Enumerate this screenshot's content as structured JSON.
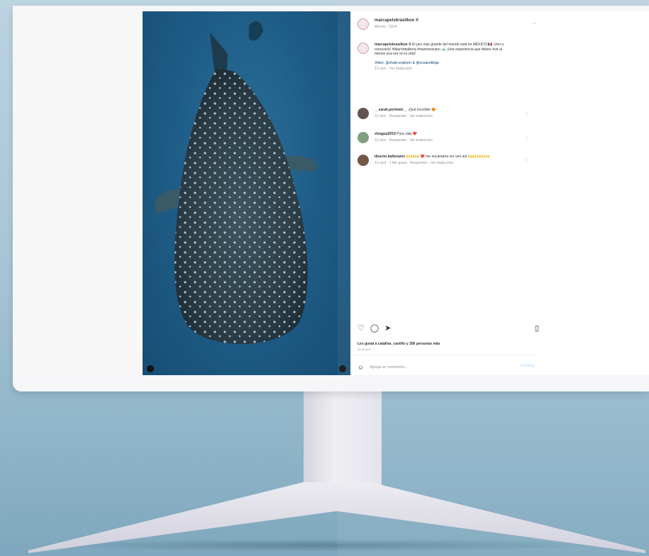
{
  "header": {
    "username": "marcapelsbrasilkoe ®",
    "subtitle": "México · 2024",
    "more_icon": "more-horizontal-icon"
  },
  "caption": {
    "username": "marcapelsbrasilkoe ®",
    "text": "El pez más grande del mundo está en MÉXICO 🇲🇽 ¡Ven a conocerlo! #tiburónballena #marmexicano 🐋 ¡Una experiencia que debes vivir al menos una vez en la vida!",
    "credit": "Video: @shark.explorer & @oceanofbaja",
    "meta": "13 sem · Ver traducción"
  },
  "comments": [
    {
      "username": "__sarah.perlewin__",
      "text": "¡Qué increíble 😍",
      "meta": "13 sem · Responder · Ver traducción",
      "avatar": "dark"
    },
    {
      "username": "vivagua2019",
      "text": "Pura vida ❤️",
      "meta": "13 sem · Responder · Ver traducción",
      "avatar": "green"
    },
    {
      "username": "tiburón.ballenamx",
      "text": "🙌🙌🙌 ❤️ me encantaría ver uno así 🙌🙌🙌🙌🙌",
      "meta": "13 sem · 1 Me gusta · Responder · Ver traducción",
      "avatar": "brown"
    }
  ],
  "actions": {
    "like_icon": "heart-icon",
    "comment_icon": "comment-icon",
    "share_icon": "send-icon",
    "save_icon": "bookmark-icon",
    "likes_text": "Les gusta a catalina_castillo y 356 personas más",
    "date": "22 de abril"
  },
  "comment_input": {
    "placeholder": "Agrega un comentario...",
    "post_label": "Publicar"
  },
  "colors": {
    "ocean": "#1f5e88",
    "panel": "#ffffff",
    "link": "#00376b"
  }
}
